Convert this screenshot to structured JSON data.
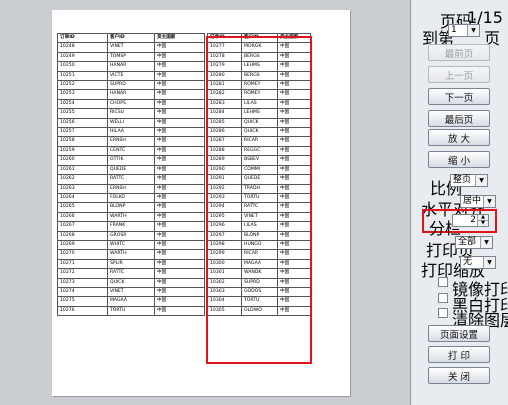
{
  "page_info": {
    "label": "页码:",
    "value": "1/15"
  },
  "goto": {
    "prefix": "到第",
    "value": "1",
    "suffix": "页"
  },
  "buttons": {
    "first": "最前页",
    "prev": "上一页",
    "next": "下一页",
    "last": "最后页",
    "zoom_in": "放 大",
    "zoom_out": "缩 小",
    "page_setup": "页面设置",
    "print": "打 印",
    "close": "关 闭"
  },
  "scale": {
    "label": "比例",
    "value": "整页"
  },
  "halign": {
    "label": "水平对齐",
    "value": "居中"
  },
  "columns_split": {
    "label": "分栏",
    "value": "2"
  },
  "print_pages": {
    "label": "打印页",
    "value": "全部"
  },
  "print_scale": {
    "label": "打印缩放",
    "value": "无"
  },
  "options": {
    "mirror": "镜像打印",
    "bw": "黑白打印",
    "clear_layers": "清除图层"
  },
  "table": {
    "headers": [
      "订单ID",
      "客户ID",
      "货主国家"
    ],
    "left_rows": [
      [
        "10248",
        "VINET",
        "中国"
      ],
      [
        "10249",
        "TOMSP",
        "中国"
      ],
      [
        "10250",
        "HANAR",
        "中国"
      ],
      [
        "10251",
        "VICTE",
        "中国"
      ],
      [
        "10252",
        "SUPRD",
        "中国"
      ],
      [
        "10253",
        "HANAR",
        "中国"
      ],
      [
        "10254",
        "CHOPS",
        "中国"
      ],
      [
        "10255",
        "RICSU",
        "中国"
      ],
      [
        "10256",
        "WELLI",
        "中国"
      ],
      [
        "10257",
        "HILAA",
        "中国"
      ],
      [
        "10258",
        "ERNSH",
        "中国"
      ],
      [
        "10259",
        "CENTC",
        "中国"
      ],
      [
        "10260",
        "OTTIK",
        "中国"
      ],
      [
        "10261",
        "QUEDE",
        "中国"
      ],
      [
        "10262",
        "RATTC",
        "中国"
      ],
      [
        "10263",
        "ERNSH",
        "中国"
      ],
      [
        "10264",
        "FOLKO",
        "中国"
      ],
      [
        "10265",
        "BLONP",
        "中国"
      ],
      [
        "10266",
        "WARTH",
        "中国"
      ],
      [
        "10267",
        "FRANK",
        "中国"
      ],
      [
        "10268",
        "GROSR",
        "中国"
      ],
      [
        "10269",
        "WHITC",
        "中国"
      ],
      [
        "10270",
        "WARTH",
        "中国"
      ],
      [
        "10271",
        "SPLIR",
        "中国"
      ],
      [
        "10272",
        "RATTC",
        "中国"
      ],
      [
        "10273",
        "QUICK",
        "中国"
      ],
      [
        "10274",
        "VINET",
        "中国"
      ],
      [
        "10275",
        "MAGAA",
        "中国"
      ],
      [
        "10276",
        "TORTU",
        "中国"
      ]
    ],
    "right_rows": [
      [
        "10277",
        "MORGK",
        "中国"
      ],
      [
        "10278",
        "BERGS",
        "中国"
      ],
      [
        "10279",
        "LEHMS",
        "中国"
      ],
      [
        "10280",
        "BERGS",
        "中国"
      ],
      [
        "10281",
        "ROMEY",
        "中国"
      ],
      [
        "10282",
        "ROMEY",
        "中国"
      ],
      [
        "10283",
        "LILAS",
        "中国"
      ],
      [
        "10284",
        "LEHMS",
        "中国"
      ],
      [
        "10285",
        "QUICK",
        "中国"
      ],
      [
        "10286",
        "QUICK",
        "中国"
      ],
      [
        "10287",
        "RICAR",
        "中国"
      ],
      [
        "10288",
        "REGGC",
        "中国"
      ],
      [
        "10289",
        "BSBEV",
        "中国"
      ],
      [
        "10290",
        "COMMI",
        "中国"
      ],
      [
        "10291",
        "QUEDE",
        "中国"
      ],
      [
        "10292",
        "TRADH",
        "中国"
      ],
      [
        "10293",
        "TORTU",
        "中国"
      ],
      [
        "10294",
        "RATTC",
        "中国"
      ],
      [
        "10295",
        "VINET",
        "中国"
      ],
      [
        "10296",
        "LILAS",
        "中国"
      ],
      [
        "10297",
        "BLONP",
        "中国"
      ],
      [
        "10298",
        "HUNGO",
        "中国"
      ],
      [
        "10299",
        "RICAR",
        "中国"
      ],
      [
        "10300",
        "MAGAA",
        "中国"
      ],
      [
        "10301",
        "WANDK",
        "中国"
      ],
      [
        "10302",
        "SUPRD",
        "中国"
      ],
      [
        "10303",
        "GODOS",
        "中国"
      ],
      [
        "10304",
        "TORTU",
        "中国"
      ],
      [
        "10305",
        "OLDWO",
        "中国"
      ]
    ]
  },
  "colors": {
    "highlight": "#e0141b"
  }
}
